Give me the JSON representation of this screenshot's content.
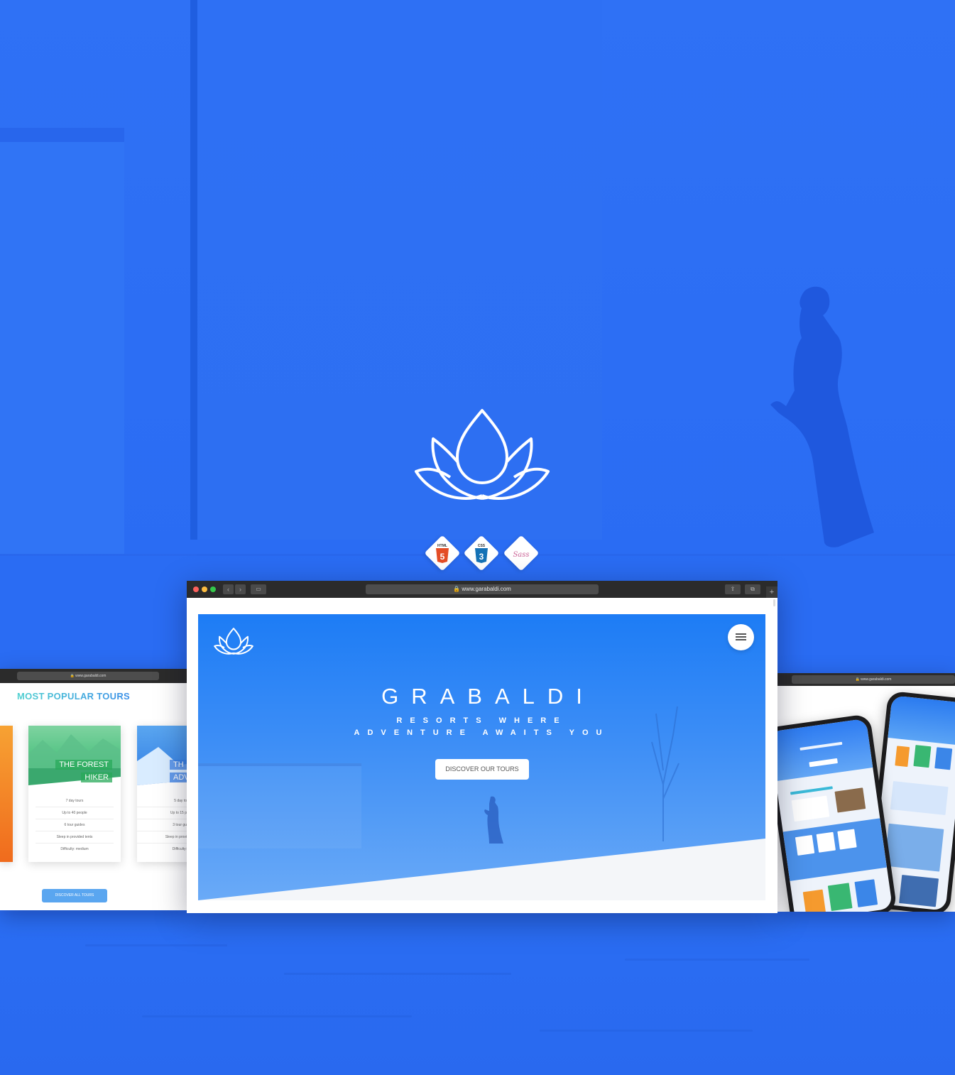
{
  "browser": {
    "url": "www.garabaldi.com"
  },
  "hero": {
    "title": "GRABALDI",
    "subtitle": "RESORTS WHERE ADVENTURE AWAITS YOU",
    "button_label": "DISCOVER OUR TOURS"
  },
  "badges": [
    {
      "label": "HTML",
      "glyph": "5",
      "color": "#e44d26"
    },
    {
      "label": "CSS",
      "glyph": "3",
      "color": "#1572b6"
    },
    {
      "label": "Sass",
      "color": "#cd6799"
    }
  ],
  "left_window": {
    "url": "www.garabaldi.com",
    "heading": "MOST POPULAR TOURS",
    "cards": [
      {
        "name_line1": "THE FOREST",
        "name_line2": "HIKER",
        "features": [
          "7 day tours",
          "Up to 40 people",
          "6 tour guides",
          "Sleep in provided tents",
          "Difficulty: medium"
        ]
      },
      {
        "name_line1": "TH",
        "name_line2": "ADV",
        "features": [
          "5 day to",
          "Up to 15 p",
          "3 tour gu",
          "Sleep in provi",
          "Difficulty:"
        ]
      }
    ],
    "button_label": "DISCOVER ALL TOURS"
  },
  "right_window": {
    "url": "www.garabaldi.com"
  },
  "colors": {
    "background": "#2b6ff2",
    "hero_top": "#1d7cf5",
    "accent": "#5aa6f0"
  },
  "icons": [
    "lotus-logo-icon",
    "html5-icon",
    "css3-icon",
    "sass-icon",
    "menu-icon",
    "lock-icon"
  ]
}
